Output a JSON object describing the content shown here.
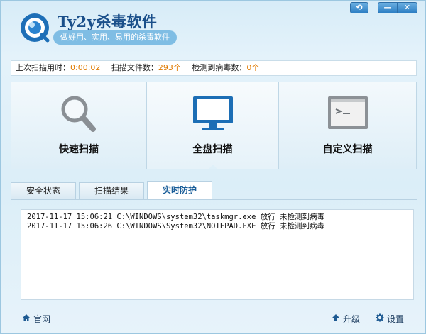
{
  "app": {
    "title": "Ty2y杀毒软件",
    "slogan": "做好用、实用、易用的杀毒软件"
  },
  "window_controls": {
    "skin": "⟲",
    "minimize": "—",
    "close": "✕"
  },
  "stats": {
    "last_scan_label": "上次扫描用时：",
    "last_scan_value": "0:00:02",
    "files_label": "扫描文件数：",
    "files_value": "293个",
    "virus_label": "检测到病毒数：",
    "virus_value": "0个"
  },
  "scan_buttons": [
    {
      "label": "快速扫描",
      "icon": "magnifier-icon"
    },
    {
      "label": "全盘扫描",
      "icon": "monitor-icon"
    },
    {
      "label": "自定义扫描",
      "icon": "terminal-icon"
    }
  ],
  "tabs": [
    {
      "label": "安全状态"
    },
    {
      "label": "扫描结果"
    },
    {
      "label": "实时防护",
      "active": true
    }
  ],
  "log": [
    "2017-11-17 15:06:21 C:\\WINDOWS\\system32\\taskmgr.exe 放行 未检测到病毒",
    "2017-11-17 15:06:26 C:\\WINDOWS\\System32\\NOTEPAD.EXE 放行 未检测到病毒"
  ],
  "footer": {
    "website": "官网",
    "upgrade": "升级",
    "settings": "设置"
  },
  "colors": {
    "accent": "#1a4f8a",
    "highlight_value": "#e07a00",
    "panel_bg": "#e4f2fa"
  }
}
